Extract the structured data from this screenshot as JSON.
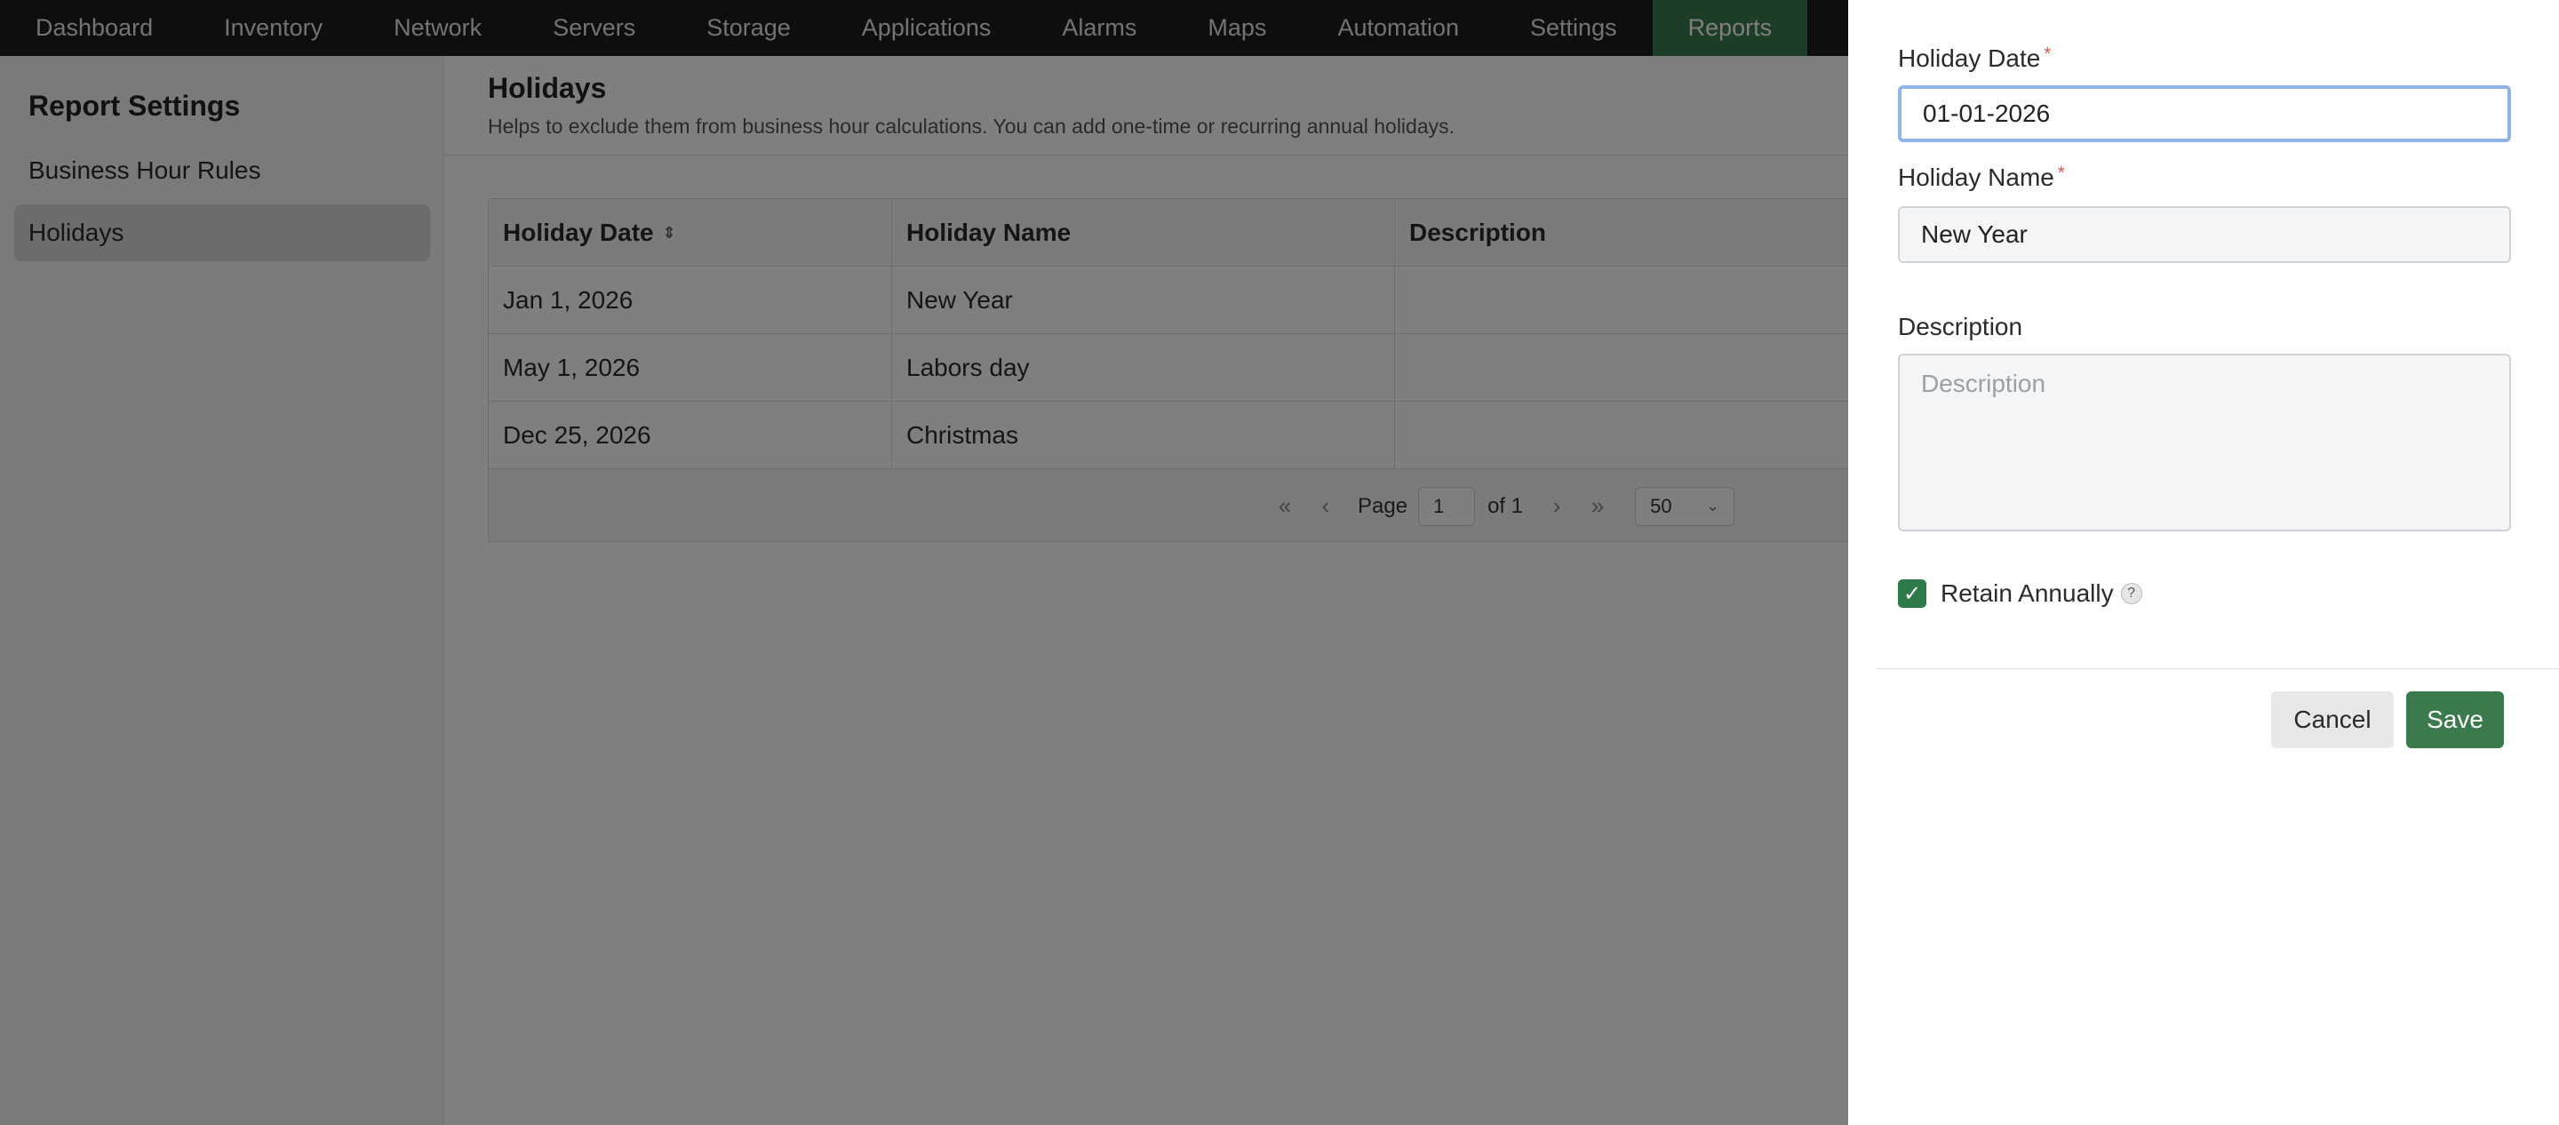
{
  "nav": {
    "items": [
      "Dashboard",
      "Inventory",
      "Network",
      "Servers",
      "Storage",
      "Applications",
      "Alarms",
      "Maps",
      "Automation",
      "Settings",
      "Reports"
    ],
    "active": "Reports"
  },
  "sidebar": {
    "title": "Report Settings",
    "items": [
      {
        "label": "Business Hour Rules"
      },
      {
        "label": "Holidays"
      }
    ]
  },
  "page": {
    "title": "Holidays",
    "subtitle": "Helps to exclude them from business hour calculations. You can add one-time or recurring annual holidays."
  },
  "table": {
    "columns": [
      "Holiday Date",
      "Holiday Name",
      "Description"
    ],
    "rows": [
      {
        "date": "Jan 1, 2026",
        "name": "New Year",
        "description": ""
      },
      {
        "date": "May 1, 2026",
        "name": "Labors day",
        "description": ""
      },
      {
        "date": "Dec 25, 2026",
        "name": "Christmas",
        "description": ""
      }
    ]
  },
  "pagination": {
    "page_label": "Page",
    "current_page": "1",
    "of_label": "of 1",
    "page_size": "50"
  },
  "form": {
    "date_label": "Holiday Date",
    "date_value": "01-01-2026",
    "name_label": "Holiday Name",
    "name_value": "New Year",
    "description_label": "Description",
    "description_placeholder": "Description",
    "retain_label": "Retain Annually",
    "retain_checked": true,
    "required_mark": "*",
    "cancel_label": "Cancel",
    "save_label": "Save"
  },
  "colors": {
    "accent": "#3b7a4d",
    "nav_bg": "#1c1c1c",
    "focus_ring": "#8fb4e8"
  }
}
